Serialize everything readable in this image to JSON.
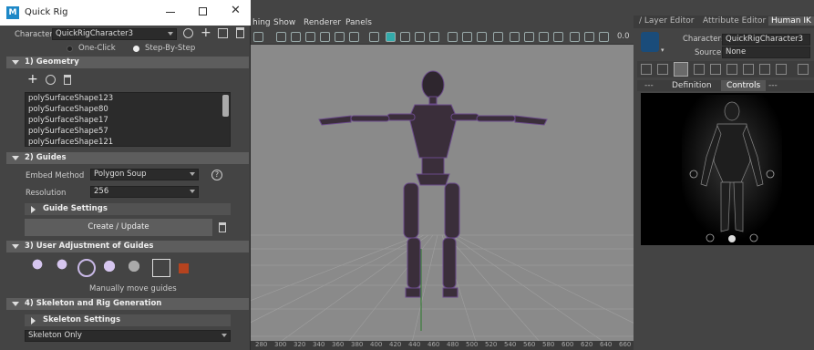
{
  "quick_rig": {
    "title": "Quick Rig",
    "character_label": "Character:",
    "character_value": "QuickRigCharacter3",
    "mode_one_click": "One-Click",
    "mode_step_by_step": "Step-By-Step",
    "sections": {
      "geometry": "1) Geometry",
      "guides": "2) Guides",
      "user_adjustment": "3) User Adjustment of Guides",
      "skeleton": "4) Skeleton and Rig Generation"
    },
    "geometry_list": [
      "polySurfaceShape123",
      "polySurfaceShape80",
      "polySurfaceShape17",
      "polySurfaceShape57",
      "polySurfaceShape121"
    ],
    "embed_method_label": "Embed Method",
    "embed_method_value": "Polygon Soup",
    "resolution_label": "Resolution",
    "resolution_value": "256",
    "guide_settings": "Guide Settings",
    "create_update": "Create / Update",
    "manually_move": "Manually move guides",
    "skeleton_settings": "Skeleton Settings",
    "skeleton_only": "Skeleton Only"
  },
  "viewport": {
    "menus": [
      "hing",
      "Show",
      "Renderer",
      "Panels"
    ],
    "value_readout": "0.0",
    "ruler_ticks": [
      "280",
      "300",
      "320",
      "340",
      "360",
      "380",
      "400",
      "420",
      "440",
      "460",
      "480",
      "500",
      "520",
      "540",
      "560",
      "580",
      "600",
      "620",
      "640",
      "660"
    ]
  },
  "right_panel": {
    "tabs": [
      "/ Layer Editor",
      "Attribute Editor",
      "Human IK"
    ],
    "character_label": "Character:",
    "character_value": "QuickRigCharacter3",
    "source_label": "Source:",
    "source_value": "None",
    "subtabs": [
      "---",
      "Definition",
      "Controls",
      "---"
    ]
  },
  "colors": {
    "accent_red": "#b5431f",
    "rig_purple": "#5a3a7a",
    "viewport_bg": "#8a8a8a"
  }
}
